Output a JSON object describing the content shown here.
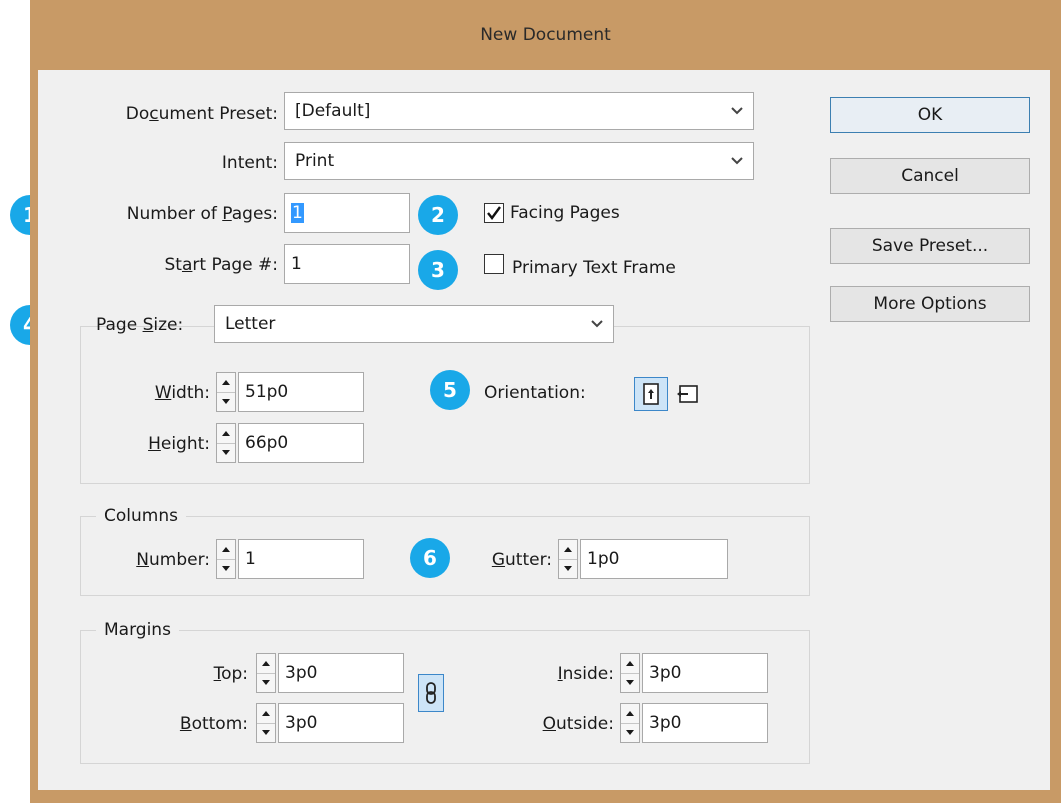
{
  "dialog": {
    "title": "New Document"
  },
  "fields": {
    "document_preset": {
      "label_pre": "Do",
      "label_u": "c",
      "label_post": "ument Preset:",
      "value": "[Default]"
    },
    "intent": {
      "label": "Intent:",
      "value": "Print"
    },
    "number_of_pages": {
      "label_pre": "Number of ",
      "label_u": "P",
      "label_post": "ages:",
      "value": "1"
    },
    "start_page": {
      "label_pre": "St",
      "label_u": "a",
      "label_post": "rt Page #:",
      "value": "1"
    },
    "facing_pages": {
      "label": "Facing Pages",
      "checked": true
    },
    "primary_text_frame": {
      "label": "Primary Text Frame",
      "checked": false
    }
  },
  "page_size": {
    "label_pre": "Page ",
    "label_u": "S",
    "label_post": "ize:",
    "value": "Letter",
    "width": {
      "label_u": "W",
      "label_post": "idth:",
      "value": "51p0"
    },
    "height": {
      "label_u": "H",
      "label_post": "eight:",
      "value": "66p0"
    },
    "orientation_label": "Orientation:",
    "orientation": "portrait"
  },
  "columns": {
    "legend": "Columns",
    "number": {
      "label_u": "N",
      "label_post": "umber:",
      "value": "1"
    },
    "gutter": {
      "label_u": "G",
      "label_post": "utter:",
      "value": "1p0"
    }
  },
  "margins": {
    "legend": "Margins",
    "top": {
      "label_u": "T",
      "label_post": "op:",
      "value": "3p0"
    },
    "bottom": {
      "label_u": "B",
      "label_post": "ottom:",
      "value": "3p0"
    },
    "inside": {
      "label_u": "I",
      "label_post": "nside:",
      "value": "3p0"
    },
    "outside": {
      "label_u": "O",
      "label_post": "utside:",
      "value": "3p0"
    },
    "linked": true
  },
  "buttons": {
    "ok": "OK",
    "cancel": "Cancel",
    "save_preset": "Save Preset...",
    "more_options": "More Options"
  },
  "badges": [
    "1",
    "2",
    "3",
    "4",
    "5",
    "6"
  ],
  "colors": {
    "title_bar": "#c89a66",
    "badge": "#19a8e8",
    "selection": "#3399ff"
  }
}
